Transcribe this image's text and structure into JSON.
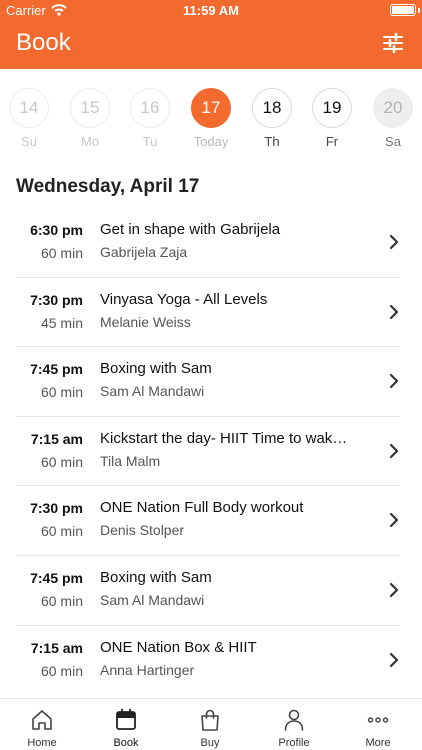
{
  "status_bar": {
    "carrier": "Carrier",
    "time": "11:59 AM"
  },
  "header": {
    "title": "Book",
    "filter_icon": "sliders-icon",
    "background": "#f26a2e"
  },
  "day_strip": [
    {
      "number": "14",
      "name": "Su",
      "state": "past"
    },
    {
      "number": "15",
      "name": "Mo",
      "state": "past"
    },
    {
      "number": "16",
      "name": "Tu",
      "state": "past"
    },
    {
      "number": "17",
      "name": "Today",
      "state": "selected"
    },
    {
      "number": "18",
      "name": "Th",
      "state": "future"
    },
    {
      "number": "19",
      "name": "Fr",
      "state": "future"
    },
    {
      "number": "20",
      "name": "Sa",
      "state": "disabled"
    }
  ],
  "date_heading": "Wednesday, April 17",
  "classes": [
    {
      "time": "6:30 pm",
      "duration": "60 min",
      "title": "Get in shape with Gabrijela",
      "instructor": "Gabrijela Zaja"
    },
    {
      "time": "7:30 pm",
      "duration": "45 min",
      "title": "Vinyasa Yoga - All Levels",
      "instructor": "Melanie Weiss"
    },
    {
      "time": "7:45 pm",
      "duration": "60 min",
      "title": "Boxing with Sam",
      "instructor": "Sam Al Mandawi"
    },
    {
      "time": "7:15 am",
      "duration": "60 min",
      "title": "Kickstart the day- HIIT Time to wak…",
      "instructor": "Tila Malm"
    },
    {
      "time": "7:30 pm",
      "duration": "60 min",
      "title": "ONE Nation Full Body workout",
      "instructor": "Denis Stolper"
    },
    {
      "time": "7:45 pm",
      "duration": "60 min",
      "title": "Boxing with Sam",
      "instructor": "Sam Al Mandawi"
    },
    {
      "time": "7:15 am",
      "duration": "60 min",
      "title": "ONE Nation Box & HIIT",
      "instructor": "Anna Hartinger"
    }
  ],
  "tab_bar": [
    {
      "label": "Home",
      "icon": "home-icon",
      "active": false
    },
    {
      "label": "Book",
      "icon": "calendar-icon",
      "active": true
    },
    {
      "label": "Buy",
      "icon": "shopping-bag-icon",
      "active": false
    },
    {
      "label": "Profile",
      "icon": "person-icon",
      "active": false
    },
    {
      "label": "More",
      "icon": "more-dots-icon",
      "active": false
    }
  ]
}
